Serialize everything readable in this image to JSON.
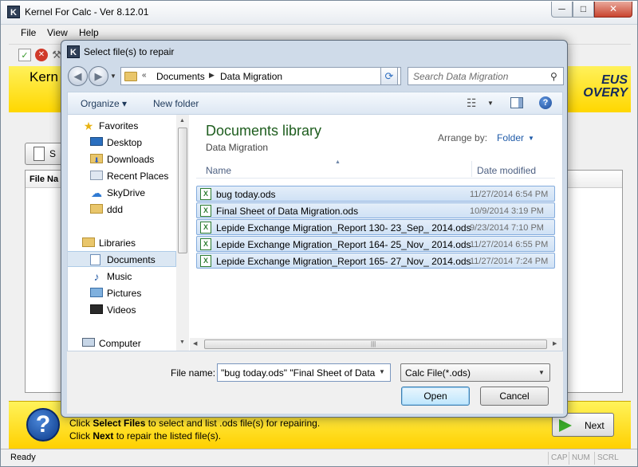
{
  "app": {
    "icon_letter": "K",
    "title": "Kernel For Calc - Ver 8.12.01",
    "window_controls": {
      "minimize": "─",
      "maximize": "□",
      "close": "✕"
    },
    "menu": [
      "File",
      "View",
      "Help"
    ],
    "banner_title": "Kern",
    "banner_logo_top": "EUS",
    "banner_logo_bottom": "OVERY",
    "select_button_label": "S",
    "file_list_header": "File Na",
    "footer": {
      "line1_prefix": "Click ",
      "line1_bold": "Select Files",
      "line1_suffix": " to select and list .ods file(s) for repairing.",
      "line2_prefix": "Click ",
      "line2_bold": "Next",
      "line2_suffix": " to repair the listed file(s).",
      "next_label": "Next"
    },
    "status": {
      "text": "Ready",
      "cap": "CAP",
      "num": "NUM",
      "scrl": "SCRL"
    }
  },
  "dialog": {
    "icon_letter": "K",
    "title": "Select file(s) to repair",
    "address": {
      "crumbs": [
        "Documents",
        "Data Migration"
      ]
    },
    "search": {
      "placeholder": "Search Data Migration"
    },
    "commands": {
      "organize": "Organize ▾",
      "new_folder": "New folder"
    },
    "nav_pane": {
      "favorites_label": "Favorites",
      "favorites": [
        "Desktop",
        "Downloads",
        "Recent Places",
        "SkyDrive",
        "ddd"
      ],
      "libraries_label": "Libraries",
      "libraries": [
        "Documents",
        "Music",
        "Pictures",
        "Videos"
      ],
      "computer_label": "Computer",
      "selected": "Documents"
    },
    "library": {
      "title": "Documents library",
      "subtitle": "Data Migration",
      "arrange_label": "Arrange by:",
      "arrange_value": "Folder"
    },
    "columns": {
      "name": "Name",
      "date_modified": "Date modified"
    },
    "files": [
      {
        "name": "bug today.ods",
        "date": "11/27/2014 6:54 PM"
      },
      {
        "name": "Final Sheet of Data Migration.ods",
        "date": "10/9/2014 3:19 PM"
      },
      {
        "name": "Lepide Exchange Migration_Report 130- 23_Sep_ 2014.ods",
        "date": "9/23/2014 7:10 PM"
      },
      {
        "name": "Lepide Exchange Migration_Report 164- 25_Nov_ 2014.ods",
        "date": "11/27/2014 6:55 PM"
      },
      {
        "name": "Lepide Exchange Migration_Report 165- 27_Nov_ 2014.ods",
        "date": "11/27/2014 7:24 PM"
      }
    ],
    "file_name_label": "File name:",
    "file_name_value": "\"bug today.ods\" \"Final Sheet of Data",
    "file_type": "Calc File(*.ods)",
    "open_label": "Open",
    "cancel_label": "Cancel"
  },
  "colors": {
    "banner_yellow": "#ffe000",
    "library_title_green": "#1e5d1e",
    "selection_blue": "#cfe1f5",
    "link_blue": "#1e5aa8"
  }
}
